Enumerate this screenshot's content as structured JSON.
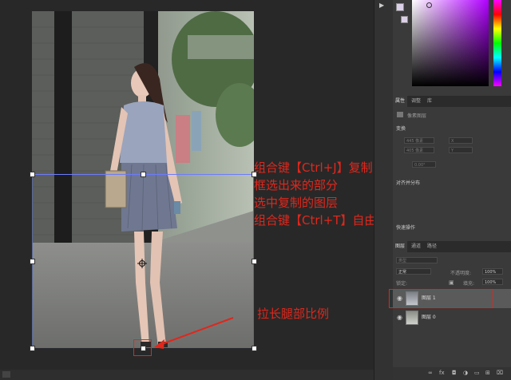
{
  "annotations": {
    "line1": "组合键【Ctrl+J】复制",
    "line2": "框选出来的部分",
    "line3": "选中复制的图层",
    "line4": "组合键【Ctrl+T】自由变换",
    "leg_note": "拉长腿部比例"
  },
  "colors": {
    "accent_red": "#e0271c",
    "panel_bg": "#3a3a3a",
    "selection_blue": "#5a6a9a"
  },
  "properties_panel": {
    "tabs": [
      "属性",
      "调整",
      "库"
    ],
    "doc_label": "像素图层",
    "transform_title": "变换",
    "w_value": "445 像素",
    "x_value": "X",
    "h_value": "405 像素",
    "y_value": "Y",
    "angle_value": "0.00°",
    "align_title": "对齐并分布",
    "distribute_title": "快速操作"
  },
  "layers_panel": {
    "tabs": [
      "图层",
      "通道",
      "路径"
    ],
    "search_placeholder": "类型",
    "blend_mode": "正常",
    "opacity_label": "不透明度:",
    "opacity_value": "100%",
    "lock_label": "锁定:",
    "fill_label": "填充:",
    "fill_value": "100%",
    "layers": [
      {
        "name": "图层 1",
        "selected": true
      },
      {
        "name": "图层 0",
        "selected": false
      }
    ]
  },
  "icons": [
    "play-icon",
    "eye-icon",
    "lock-icon",
    "link-icon",
    "fx-icon",
    "mask-icon",
    "adjust-icon",
    "folder-icon",
    "new-layer-icon",
    "trash-icon",
    "search-icon"
  ]
}
